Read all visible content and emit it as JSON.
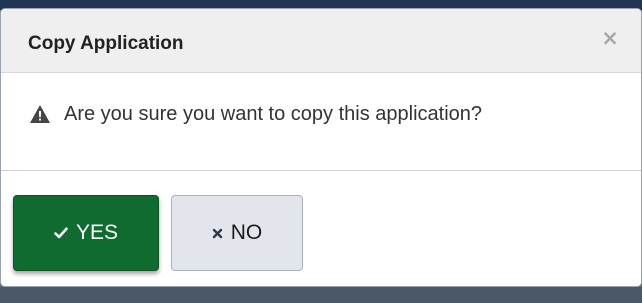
{
  "modal": {
    "title": "Copy Application",
    "close_glyph": "×",
    "message": "Are you sure you want to copy this application?",
    "warning_icon": "warning-triangle-icon"
  },
  "buttons": {
    "yes_label": "YES",
    "yes_icon": "check-icon",
    "no_label": "NO",
    "no_icon": "x-icon"
  },
  "colors": {
    "yes_bg": "#0f6b2f",
    "no_bg": "#e2e6ec",
    "header_bg": "#efefef",
    "overlay": "#5c6a7a"
  }
}
